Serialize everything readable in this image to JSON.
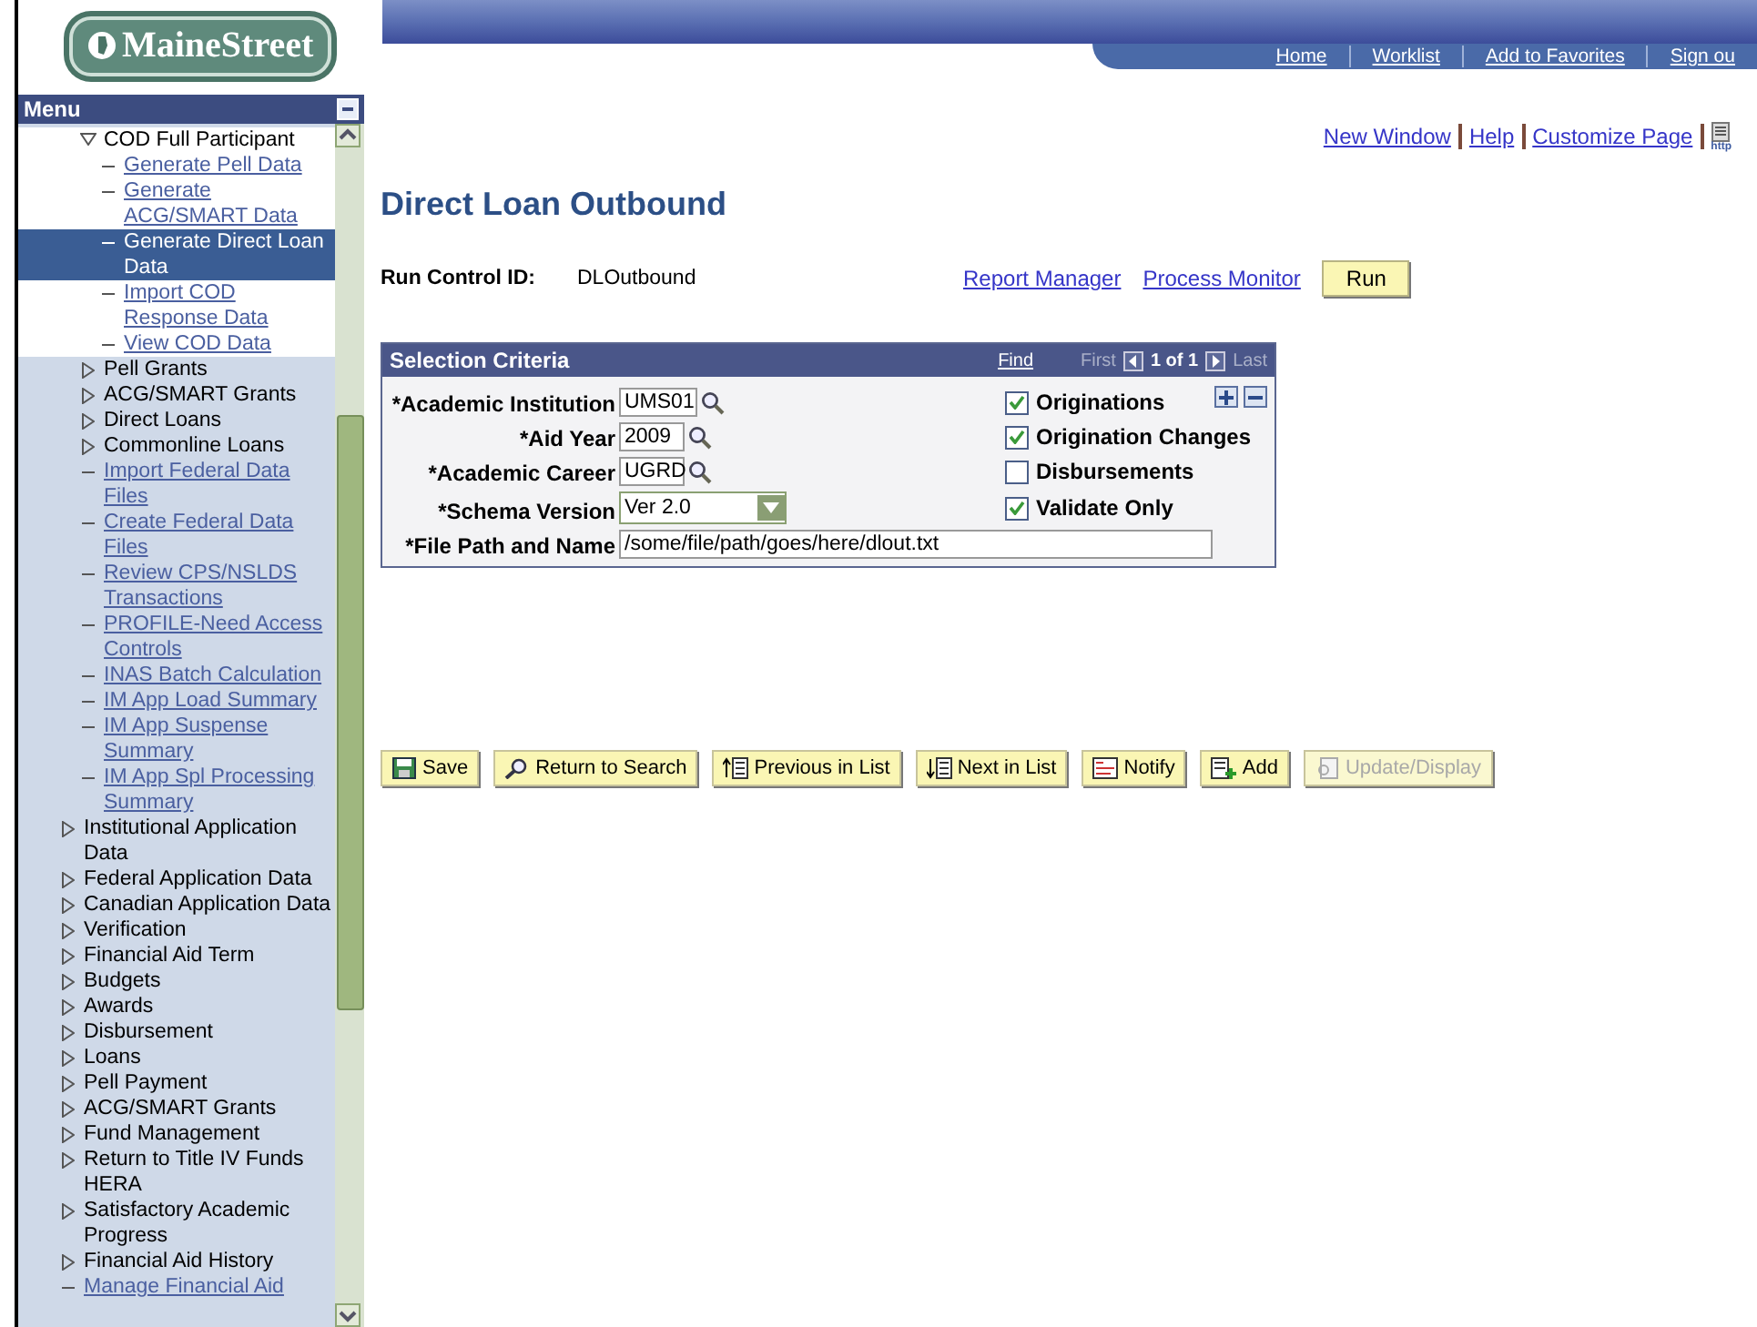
{
  "logo": {
    "text": "MaineStreet"
  },
  "header_links": [
    {
      "label": "Home"
    },
    {
      "label": "Worklist"
    },
    {
      "label": "Add to Favorites"
    },
    {
      "label": "Sign ou"
    }
  ],
  "menu": {
    "title": "Menu",
    "nested_items": [
      {
        "label": "COD Full Participant",
        "kind": "folder",
        "expanded": true,
        "selected": false,
        "children": [
          {
            "label": "Generate Pell Data",
            "kind": "link",
            "selected": false
          },
          {
            "label": "Generate ACG/SMART Data",
            "kind": "link",
            "selected": false
          },
          {
            "label": "Generate Direct Loan Data",
            "kind": "link",
            "selected": true
          },
          {
            "label": "Import COD Response Data",
            "kind": "link",
            "selected": false
          },
          {
            "label": "View COD Data",
            "kind": "link",
            "selected": false
          }
        ]
      },
      {
        "label": "Pell Grants",
        "kind": "folder",
        "expanded": false,
        "selected": false
      },
      {
        "label": "ACG/SMART Grants",
        "kind": "folder",
        "expanded": false,
        "selected": false
      },
      {
        "label": "Direct Loans",
        "kind": "folder",
        "expanded": false,
        "selected": false
      },
      {
        "label": "Commonline Loans",
        "kind": "folder",
        "expanded": false,
        "selected": false
      },
      {
        "label": "Import Federal Data Files",
        "kind": "link",
        "selected": false
      },
      {
        "label": "Create Federal Data Files",
        "kind": "link",
        "selected": false
      },
      {
        "label": "Review CPS/NSLDS Transactions",
        "kind": "link",
        "selected": false
      },
      {
        "label": "PROFILE-Need Access Controls",
        "kind": "link",
        "selected": false
      },
      {
        "label": "INAS Batch Calculation",
        "kind": "link",
        "selected": false
      },
      {
        "label": "IM App Load Summary",
        "kind": "link",
        "selected": false
      },
      {
        "label": "IM App Suspense Summary",
        "kind": "link",
        "selected": false
      },
      {
        "label": "IM App Spl Processing Summary",
        "kind": "link",
        "selected": false
      }
    ],
    "items": [
      {
        "label": "Institutional Application Data",
        "kind": "folder",
        "expanded": false,
        "selected": false
      },
      {
        "label": "Federal Application Data",
        "kind": "folder",
        "expanded": false,
        "selected": false
      },
      {
        "label": "Canadian Application Data",
        "kind": "folder",
        "expanded": false,
        "selected": false
      },
      {
        "label": "Verification",
        "kind": "folder",
        "expanded": false,
        "selected": false
      },
      {
        "label": "Financial Aid Term",
        "kind": "folder",
        "expanded": false,
        "selected": false
      },
      {
        "label": "Budgets",
        "kind": "folder",
        "expanded": false,
        "selected": false
      },
      {
        "label": "Awards",
        "kind": "folder",
        "expanded": false,
        "selected": false
      },
      {
        "label": "Disbursement",
        "kind": "folder",
        "expanded": false,
        "selected": false
      },
      {
        "label": "Loans",
        "kind": "folder",
        "expanded": false,
        "selected": false
      },
      {
        "label": "Pell Payment",
        "kind": "folder",
        "expanded": false,
        "selected": false
      },
      {
        "label": "ACG/SMART Grants",
        "kind": "folder",
        "expanded": false,
        "selected": false
      },
      {
        "label": "Fund Management",
        "kind": "folder",
        "expanded": false,
        "selected": false
      },
      {
        "label": "Return to Title IV Funds HERA",
        "kind": "folder",
        "expanded": false,
        "selected": false
      },
      {
        "label": "Satisfactory Academic Progress",
        "kind": "folder",
        "expanded": false,
        "selected": false
      },
      {
        "label": "Financial Aid History",
        "kind": "folder",
        "expanded": false,
        "selected": false
      },
      {
        "label": "Manage Financial Aid",
        "kind": "link",
        "selected": false
      }
    ]
  },
  "page_links": [
    {
      "label": "New Window"
    },
    {
      "label": "Help"
    },
    {
      "label": "Customize Page"
    }
  ],
  "http_icon_label": "http",
  "title": "Direct Loan Outbound",
  "run_control": {
    "label": "Run Control ID:",
    "value": "DLOutbound"
  },
  "process_links": [
    {
      "label": "Report Manager"
    },
    {
      "label": "Process Monitor"
    }
  ],
  "run_button": "Run",
  "selection_criteria": {
    "title": "Selection Criteria",
    "find": "Find",
    "first": "First",
    "count": "1 of 1",
    "last": "Last",
    "fields": [
      {
        "label": "*Academic Institution",
        "value": "UMS01",
        "kind": "lookup"
      },
      {
        "label": "*Aid Year",
        "value": "2009",
        "kind": "lookup"
      },
      {
        "label": "*Academic Career",
        "value": "UGRD",
        "kind": "lookup"
      },
      {
        "label": "*Schema Version",
        "value": "Ver 2.0",
        "kind": "select"
      },
      {
        "label": "*File Path and Name",
        "value": "/some/file/path/goes/here/dlout.txt",
        "kind": "text"
      }
    ],
    "checkboxes": [
      {
        "label": "Originations",
        "checked": true
      },
      {
        "label": "Origination Changes",
        "checked": true
      },
      {
        "label": "Disbursements",
        "checked": false
      },
      {
        "label": "Validate Only",
        "checked": true
      }
    ]
  },
  "toolbar": [
    {
      "label": "Save",
      "disabled": false
    },
    {
      "label": "Return to Search",
      "disabled": false
    },
    {
      "label": "Previous in List",
      "disabled": false
    },
    {
      "label": "Next in List",
      "disabled": false
    },
    {
      "label": "Notify",
      "disabled": false
    },
    {
      "label": "Add",
      "disabled": false
    },
    {
      "label": "Update/Display",
      "disabled": true
    }
  ]
}
